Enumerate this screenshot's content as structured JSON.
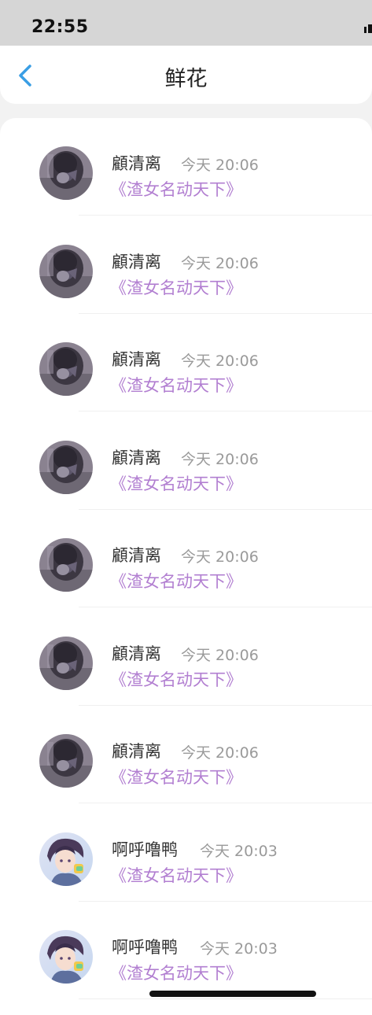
{
  "status_bar": {
    "time": "22:55"
  },
  "nav": {
    "title": "鲜花",
    "back_icon": "chevron-left-icon"
  },
  "items": [
    {
      "user": "顧清离",
      "time": "今天 20:06",
      "book": "《渣女名动天下》",
      "avatar": "dark-hair-avatar"
    },
    {
      "user": "顧清离",
      "time": "今天 20:06",
      "book": "《渣女名动天下》",
      "avatar": "dark-hair-avatar"
    },
    {
      "user": "顧清离",
      "time": "今天 20:06",
      "book": "《渣女名动天下》",
      "avatar": "dark-hair-avatar"
    },
    {
      "user": "顧清离",
      "time": "今天 20:06",
      "book": "《渣女名动天下》",
      "avatar": "dark-hair-avatar"
    },
    {
      "user": "顧清离",
      "time": "今天 20:06",
      "book": "《渣女名动天下》",
      "avatar": "dark-hair-avatar"
    },
    {
      "user": "顧清离",
      "time": "今天 20:06",
      "book": "《渣女名动天下》",
      "avatar": "dark-hair-avatar"
    },
    {
      "user": "顧清离",
      "time": "今天 20:06",
      "book": "《渣女名动天下》",
      "avatar": "dark-hair-avatar"
    },
    {
      "user": "啊呼噜鸭",
      "time": "今天 20:03",
      "book": "《渣女名动天下》",
      "avatar": "anime-boy-avatar"
    },
    {
      "user": "啊呼噜鸭",
      "time": "今天 20:03",
      "book": "《渣女名动天下》",
      "avatar": "anime-boy-avatar"
    }
  ],
  "colors": {
    "accent": "#3a9ee4",
    "book_link": "#b27fd1",
    "time_text": "#9a9a9a"
  }
}
